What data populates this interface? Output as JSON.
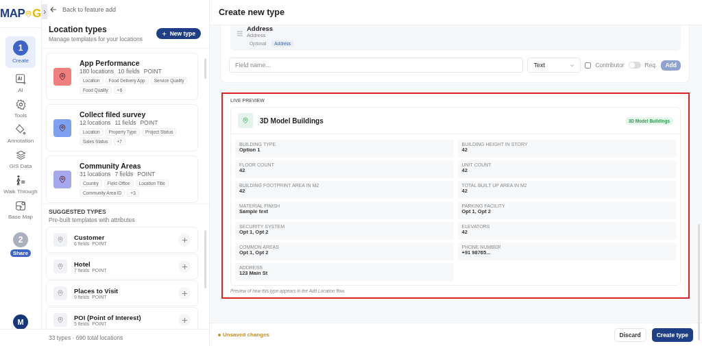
{
  "logo": {
    "text_1": "MAP",
    "text_2": "G"
  },
  "rail": {
    "steps": [
      {
        "number": "1",
        "label": "Create",
        "selected": true,
        "tools": [
          {
            "kind": "ai",
            "label": "AI"
          },
          {
            "kind": "tools",
            "label": "Tools"
          },
          {
            "kind": "annotation",
            "label": "Annotation"
          },
          {
            "kind": "gis",
            "label": "GIS Data"
          },
          {
            "kind": "walk",
            "label": "Walk Through"
          },
          {
            "kind": "basemap",
            "label": "Base Map"
          }
        ]
      },
      {
        "number": "2",
        "label": "Share",
        "selected": false
      }
    ],
    "avatar": "M"
  },
  "panel": {
    "back": "Back to feature add",
    "title": "Location types",
    "subtitle": "Manage templates for your locations",
    "new_button": "New type",
    "types": [
      {
        "name": "App Performance",
        "locations": "180 locations",
        "fields": "10 fields",
        "geometry": "POINT",
        "color": "#f07f7f",
        "tags": [
          "Location",
          "Food Delivery App",
          "Service Quality",
          "Food Quality",
          "+6"
        ]
      },
      {
        "name": "Collect filed survey",
        "locations": "12 locations",
        "fields": "11 fields",
        "geometry": "POINT",
        "color": "#7f9ff0",
        "tags": [
          "Location",
          "Property Type",
          "Project Status",
          "Sales Status",
          "+7"
        ]
      },
      {
        "name": "Community Areas",
        "locations": "31 locations",
        "fields": "7 fields",
        "geometry": "POINT",
        "color": "#a5a8ee",
        "tags": [
          "Country",
          "Field Office",
          "Location Title",
          "Community Area ID",
          "+3"
        ]
      }
    ],
    "suggested_title": "SUGGESTED TYPES",
    "suggested_subtitle": "Pre-built templates with attributes",
    "suggested": [
      {
        "name": "Customer",
        "fields": "6 fields",
        "geometry": "POINT"
      },
      {
        "name": "Hotel",
        "fields": "7 fields",
        "geometry": "POINT"
      },
      {
        "name": "Places to Visit",
        "fields": "9 fields",
        "geometry": "POINT"
      },
      {
        "name": "POI (Point of Interest)",
        "fields": "5 fields",
        "geometry": "POINT"
      }
    ],
    "footer": "33 types · 690 total locations"
  },
  "main": {
    "title": "Create new type",
    "field": {
      "name": "Address",
      "type": "Address",
      "tags": [
        "Optional",
        "Address"
      ]
    },
    "add_row": {
      "placeholder": "Field name...",
      "type": "Text",
      "contributor_label": "Contributor",
      "contributor_checked": false,
      "required_label": "Req.",
      "required_on": false,
      "add_button": "Add"
    },
    "preview": {
      "label": "LIVE PREVIEW",
      "name": "3D Model Buildings",
      "badge": "3D Model Buildings",
      "fields": [
        {
          "label": "BUILDING TYPE",
          "value": "Option 1"
        },
        {
          "label": "BUILDING HEIGHT IN STORY",
          "value": "42"
        },
        {
          "label": "FLOOR COUNT",
          "value": "42"
        },
        {
          "label": "UNIT COUNT",
          "value": "42"
        },
        {
          "label": "BUILDING FOOTPRINT AREA IN M2",
          "value": "42"
        },
        {
          "label": "TOTAL BUILT UP AREA IN M2",
          "value": "42"
        },
        {
          "label": "MATERIAL FINISH",
          "value": "Sample text"
        },
        {
          "label": "PARKING FACILITY",
          "value": "Opt 1, Opt 2"
        },
        {
          "label": "SECURITY SYSTEM",
          "value": "Opt 1, Opt 2"
        },
        {
          "label": "ELEVATORS",
          "value": "42"
        },
        {
          "label": "COMMON AREAS",
          "value": "Opt 1, Opt 2"
        },
        {
          "label": "PHONE NUMBER",
          "value": "+91 98765..."
        },
        {
          "label": "ADDRESS",
          "value": "123 Main St"
        }
      ],
      "caption": "Preview of how this type appears in the Add Location flow."
    },
    "status": "Unsaved changes",
    "discard": "Discard",
    "create": "Create type"
  }
}
